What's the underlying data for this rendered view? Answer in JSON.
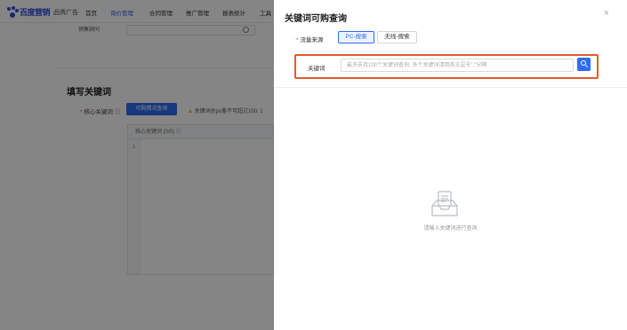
{
  "app": {
    "logo_text": "百度营销",
    "logo_sub": "品牌广告",
    "nav": [
      {
        "label": "首页",
        "active": false
      },
      {
        "label": "询价管理",
        "active": true
      },
      {
        "label": "合同管理",
        "active": false
      },
      {
        "label": "推广管理",
        "active": false
      },
      {
        "label": "报表统计",
        "active": false
      },
      {
        "label": "工具",
        "active": false
      }
    ],
    "sales_label": "销售顾问",
    "section_title": "填写关键词",
    "core_keywords_label": "核心关键词",
    "core_keywords_required": "*",
    "core_query_button": "可购情况查询",
    "warning_text": "关键词总pv量不可超过100, 1",
    "table_header": "核心关键词 (0/0)",
    "row_number": "1"
  },
  "drawer": {
    "title": "关键词可购查询",
    "close_glyph": "×",
    "traffic_source_label": "流量来源",
    "required_mark": "*",
    "source_options": [
      {
        "label": "PC-搜索",
        "selected": true
      },
      {
        "label": "无线-搜索",
        "selected": false
      }
    ],
    "keyword_label": "关键词",
    "keyword_placeholder": "最多支持100个关键词查询, 多个关键词请用英文逗号\",\"分隔",
    "keyword_value": "",
    "empty_text": "请输入关键词进行查询"
  },
  "colors": {
    "primary": "#2d6cf2",
    "highlight_frame": "#e65a2b",
    "required": "#e34d3d"
  },
  "icons": {
    "close": "close-icon",
    "search": "search-icon",
    "empty": "inbox-empty-icon",
    "help": "help-circle-icon"
  }
}
